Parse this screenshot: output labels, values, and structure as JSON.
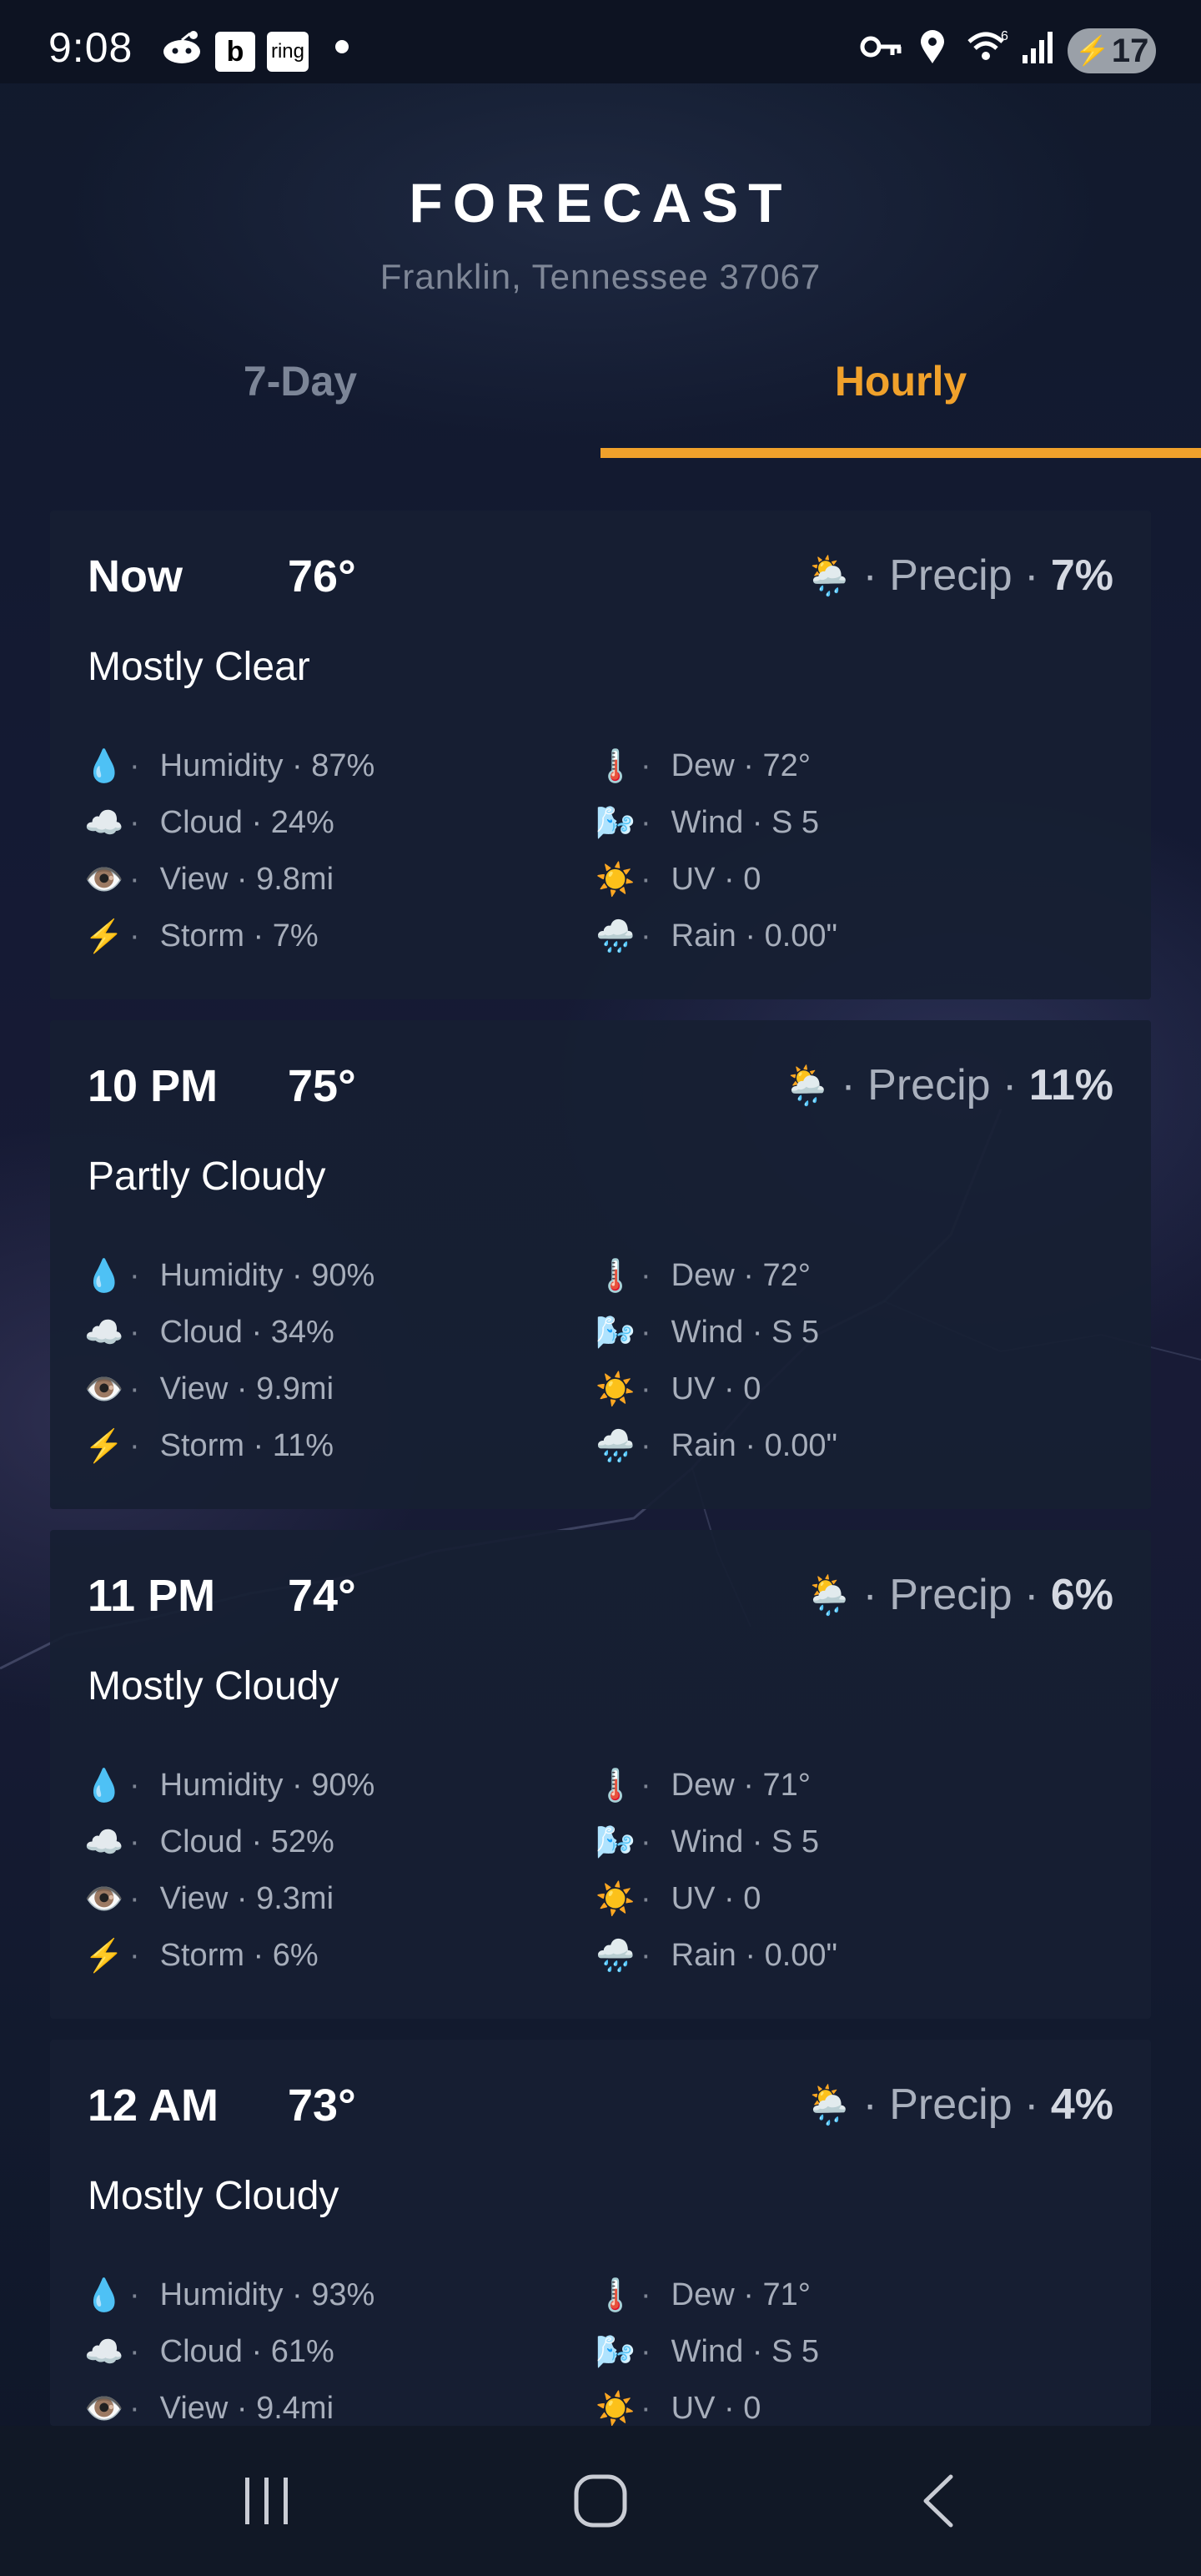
{
  "status_bar": {
    "time": "9:08",
    "icons": [
      "reddit-icon",
      "b-icon",
      "ring-icon",
      "notification-dot",
      "vpn-key-icon",
      "location-icon",
      "wifi-icon",
      "signal-icon"
    ],
    "b_label": "b",
    "ring_label": "ring",
    "battery": "17"
  },
  "header": {
    "title": "FORECAST",
    "location": "Franklin, Tennessee 37067"
  },
  "tabs": [
    {
      "label": "7-Day",
      "active": false
    },
    {
      "label": "Hourly",
      "active": true
    }
  ],
  "colors": {
    "accent": "#f0a12b",
    "card_bg": "#171f33",
    "background": "#0f1628"
  },
  "precip_label": "Precip",
  "hours": [
    {
      "time": "Now",
      "temp": "76°",
      "precip": "7%",
      "condition": "Mostly Clear",
      "humidity": "Humidity · 87%",
      "cloud": "Cloud · 24%",
      "view": "View · 9.8mi",
      "storm": "Storm · 7%",
      "dew": "Dew · 72°",
      "wind": "Wind · S 5",
      "uv": "UV · 0",
      "rain": "Rain · 0.00\""
    },
    {
      "time": "10 PM",
      "temp": "75°",
      "precip": "11%",
      "condition": "Partly Cloudy",
      "humidity": "Humidity · 90%",
      "cloud": "Cloud · 34%",
      "view": "View · 9.9mi",
      "storm": "Storm · 11%",
      "dew": "Dew · 72°",
      "wind": "Wind · S 5",
      "uv": "UV · 0",
      "rain": "Rain · 0.00\""
    },
    {
      "time": "11 PM",
      "temp": "74°",
      "precip": "6%",
      "condition": "Mostly Cloudy",
      "humidity": "Humidity · 90%",
      "cloud": "Cloud · 52%",
      "view": "View · 9.3mi",
      "storm": "Storm · 6%",
      "dew": "Dew · 71°",
      "wind": "Wind · S 5",
      "uv": "UV · 0",
      "rain": "Rain · 0.00\""
    },
    {
      "time": "12 AM",
      "temp": "73°",
      "precip": "4%",
      "condition": "Mostly Cloudy",
      "humidity": "Humidity · 93%",
      "cloud": "Cloud · 61%",
      "view": "View · 9.4mi",
      "storm": "",
      "dew": "Dew · 71°",
      "wind": "Wind · S 5",
      "uv": "UV · 0",
      "rain": ""
    }
  ],
  "nav": [
    "recent-apps-button",
    "home-button",
    "back-button"
  ]
}
